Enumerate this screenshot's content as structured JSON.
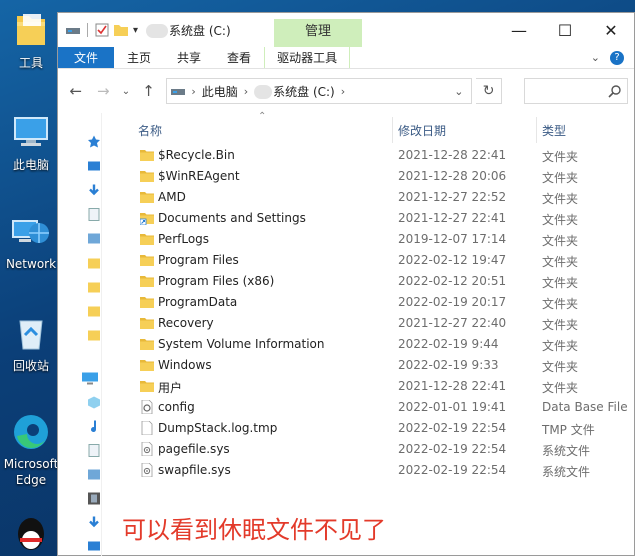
{
  "desktop": {
    "icons": [
      {
        "label": "工具",
        "icon": "folder-icon"
      },
      {
        "label": "此电脑",
        "icon": "computer-icon"
      },
      {
        "label": "Network",
        "icon": "network-icon"
      },
      {
        "label": "回收站",
        "icon": "recycle-bin-icon"
      },
      {
        "label": "Microsoft Edge",
        "icon": "edge-icon"
      },
      {
        "label": "",
        "icon": "qq-icon"
      }
    ]
  },
  "window": {
    "title": "系统盘 (C:)",
    "context_tab_group": "管理",
    "controls": {
      "minimize": "—",
      "maximize": "☐",
      "close": "✕"
    }
  },
  "ribbon": {
    "tabs": [
      "文件",
      "主页",
      "共享",
      "查看",
      "驱动器工具"
    ]
  },
  "address": {
    "crumbs": [
      "此电脑",
      "系统盘 (C:)"
    ],
    "search_placeholder": ""
  },
  "columns": {
    "name": "名称",
    "date": "修改日期",
    "type": "类型"
  },
  "files": [
    {
      "name": "$Recycle.Bin",
      "date": "2021-12-28 22:41",
      "type": "文件夹",
      "kind": "folder"
    },
    {
      "name": "$WinREAgent",
      "date": "2021-12-28 20:06",
      "type": "文件夹",
      "kind": "folder"
    },
    {
      "name": "AMD",
      "date": "2021-12-27 22:52",
      "type": "文件夹",
      "kind": "folder"
    },
    {
      "name": "Documents and Settings",
      "date": "2021-12-27 22:41",
      "type": "文件夹",
      "kind": "link"
    },
    {
      "name": "PerfLogs",
      "date": "2019-12-07 17:14",
      "type": "文件夹",
      "kind": "folder"
    },
    {
      "name": "Program Files",
      "date": "2022-02-12 19:47",
      "type": "文件夹",
      "kind": "folder"
    },
    {
      "name": "Program Files (x86)",
      "date": "2022-02-12 20:51",
      "type": "文件夹",
      "kind": "folder"
    },
    {
      "name": "ProgramData",
      "date": "2022-02-19 20:17",
      "type": "文件夹",
      "kind": "folder"
    },
    {
      "name": "Recovery",
      "date": "2021-12-27 22:40",
      "type": "文件夹",
      "kind": "folder"
    },
    {
      "name": "System Volume Information",
      "date": "2022-02-19 9:44",
      "type": "文件夹",
      "kind": "folder"
    },
    {
      "name": "Windows",
      "date": "2022-02-19 9:33",
      "type": "文件夹",
      "kind": "folder"
    },
    {
      "name": "用户",
      "date": "2021-12-28 22:41",
      "type": "文件夹",
      "kind": "folder"
    },
    {
      "name": "config",
      "date": "2022-01-01 19:41",
      "type": "Data Base File",
      "kind": "config"
    },
    {
      "name": "DumpStack.log.tmp",
      "date": "2022-02-19 22:54",
      "type": "TMP 文件",
      "kind": "file"
    },
    {
      "name": "pagefile.sys",
      "date": "2022-02-19 22:54",
      "type": "系统文件",
      "kind": "sys"
    },
    {
      "name": "swapfile.sys",
      "date": "2022-02-19 22:54",
      "type": "系统文件",
      "kind": "sys"
    }
  ],
  "annotation": "可以看到休眠文件不见了",
  "colors": {
    "accent": "#1a73c6",
    "context_tab": "#cfeebb",
    "folder": "#f6cf57",
    "annotation": "#e33a2a",
    "header_text": "#3b5b85"
  }
}
